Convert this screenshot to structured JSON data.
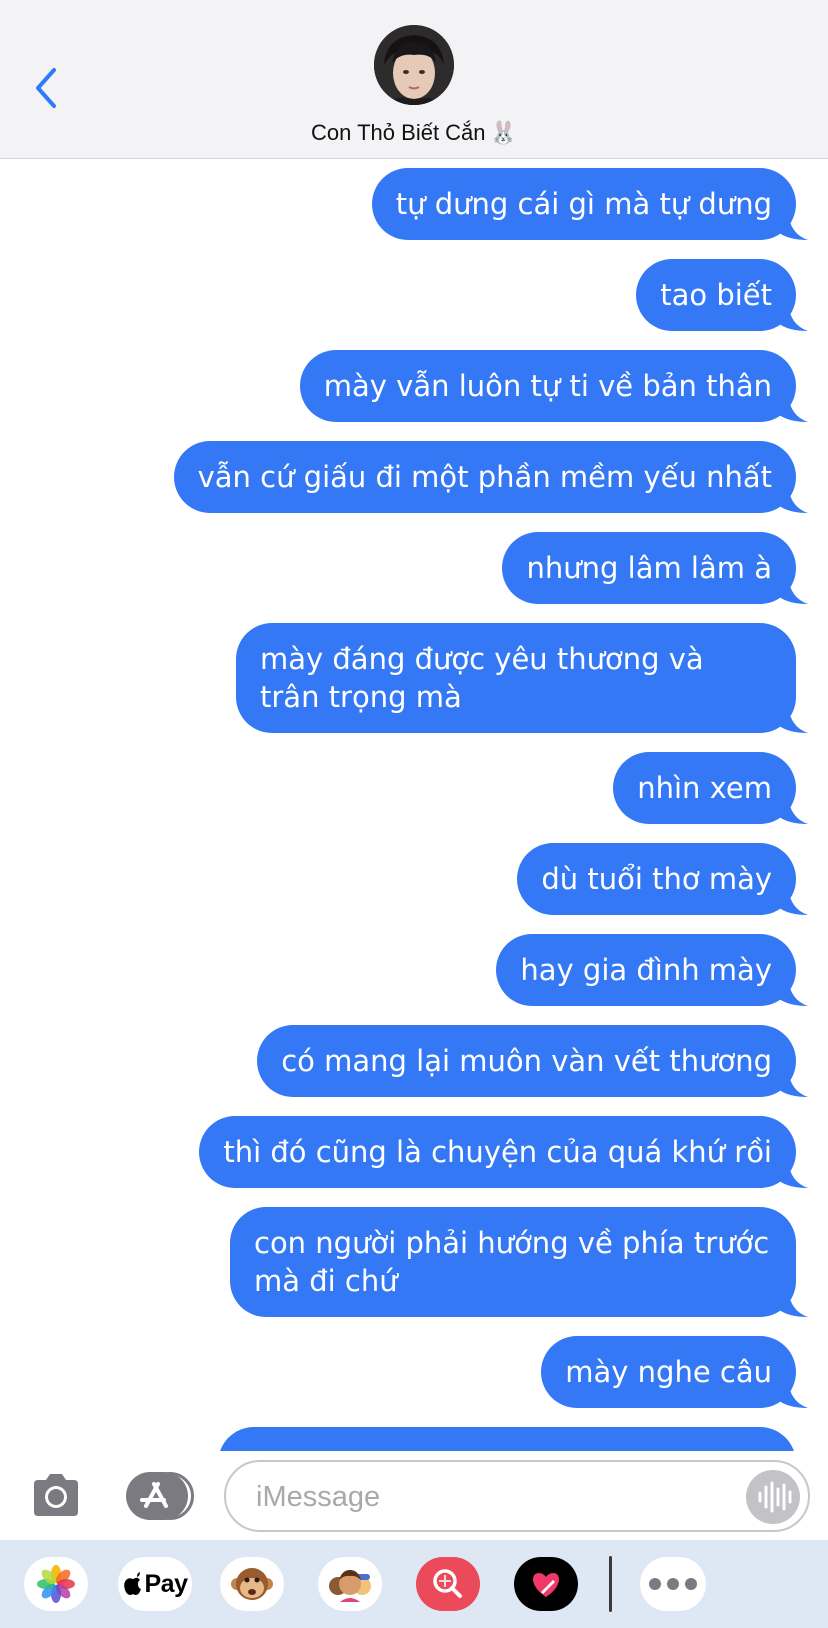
{
  "header": {
    "contact_name": "Con Thỏ Biết Cắn",
    "contact_emoji": "🐰"
  },
  "messages": [
    {
      "text": "tự dưng cái gì mà tự dưng"
    },
    {
      "text": "tao biết"
    },
    {
      "text": "mày vẫn luôn tự ti về bản thân"
    },
    {
      "text": "vẫn cứ giấu đi một phần mềm yếu nhất"
    },
    {
      "text": "nhưng lâm lâm à"
    },
    {
      "text": "mày đáng được yêu thương và trân trọng mà"
    },
    {
      "text": "nhìn xem"
    },
    {
      "text": "dù tuổi thơ mày"
    },
    {
      "text": "hay gia đình mày"
    },
    {
      "text": "có mang lại muôn vàn vết thương"
    },
    {
      "text": "thì đó cũng là chuyện của quá khứ rồi"
    },
    {
      "text": "con người phải hướng về phía trước mà đi chứ"
    },
    {
      "text": "mày nghe câu"
    }
  ],
  "input": {
    "placeholder": "iMessage"
  },
  "drawer": {
    "apple_pay_label": "Pay"
  },
  "colors": {
    "bubble": "#3478f6",
    "accent": "#2f7cf6",
    "header_bg": "#f3f3f5",
    "drawer_bg": "#dee8f5"
  },
  "icons": {
    "back": "chevron-left-icon",
    "camera": "camera-icon",
    "apps": "app-store-icon",
    "mic": "audio-waveform-icon",
    "photos": "photos-app-icon",
    "apple_pay": "apple-pay-icon",
    "animoji": "monkey-animoji-icon",
    "memoji": "memoji-stickers-icon",
    "search": "images-search-icon",
    "digital_touch": "digital-touch-icon",
    "more": "more-dots-icon"
  }
}
